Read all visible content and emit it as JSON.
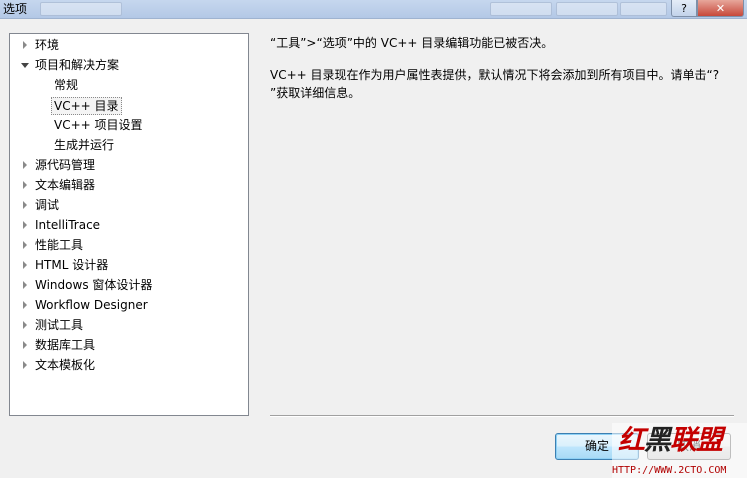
{
  "window": {
    "title": "选项",
    "help_label": "?",
    "close_label": "✕"
  },
  "tree": {
    "items": [
      {
        "label": "环境",
        "state": "collapsed",
        "level": 0
      },
      {
        "label": "项目和解决方案",
        "state": "expanded",
        "level": 0
      },
      {
        "label": "常规",
        "state": "leaf",
        "level": 1
      },
      {
        "label": "VC++ 目录",
        "state": "selected",
        "level": 1
      },
      {
        "label": "VC++ 项目设置",
        "state": "leaf",
        "level": 1
      },
      {
        "label": "生成并运行",
        "state": "leaf",
        "level": 1
      },
      {
        "label": "源代码管理",
        "state": "collapsed",
        "level": 0
      },
      {
        "label": "文本编辑器",
        "state": "collapsed",
        "level": 0
      },
      {
        "label": "调试",
        "state": "collapsed",
        "level": 0
      },
      {
        "label": "IntelliTrace",
        "state": "collapsed",
        "level": 0
      },
      {
        "label": "性能工具",
        "state": "collapsed",
        "level": 0
      },
      {
        "label": "HTML 设计器",
        "state": "collapsed",
        "level": 0
      },
      {
        "label": "Windows 窗体设计器",
        "state": "collapsed",
        "level": 0
      },
      {
        "label": "Workflow Designer",
        "state": "collapsed",
        "level": 0
      },
      {
        "label": "测试工具",
        "state": "collapsed",
        "level": 0
      },
      {
        "label": "数据库工具",
        "state": "collapsed",
        "level": 0
      },
      {
        "label": "文本模板化",
        "state": "collapsed",
        "level": 0
      }
    ]
  },
  "content": {
    "line1": "“工具”>“选项”中的 VC++ 目录编辑功能已被否决。",
    "line2": "VC++ 目录现在作为用户属性表提供，默认情况下将会添加到所有项目中。请单击“?",
    "line3": "”获取详细信息。"
  },
  "buttons": {
    "ok_label": "确定",
    "cancel_label": "取消"
  },
  "watermark": {
    "logo_a": "红",
    "logo_b": "黑",
    "logo_c": "联盟",
    "url": "HTTP://WWW.2CTO.COM"
  }
}
